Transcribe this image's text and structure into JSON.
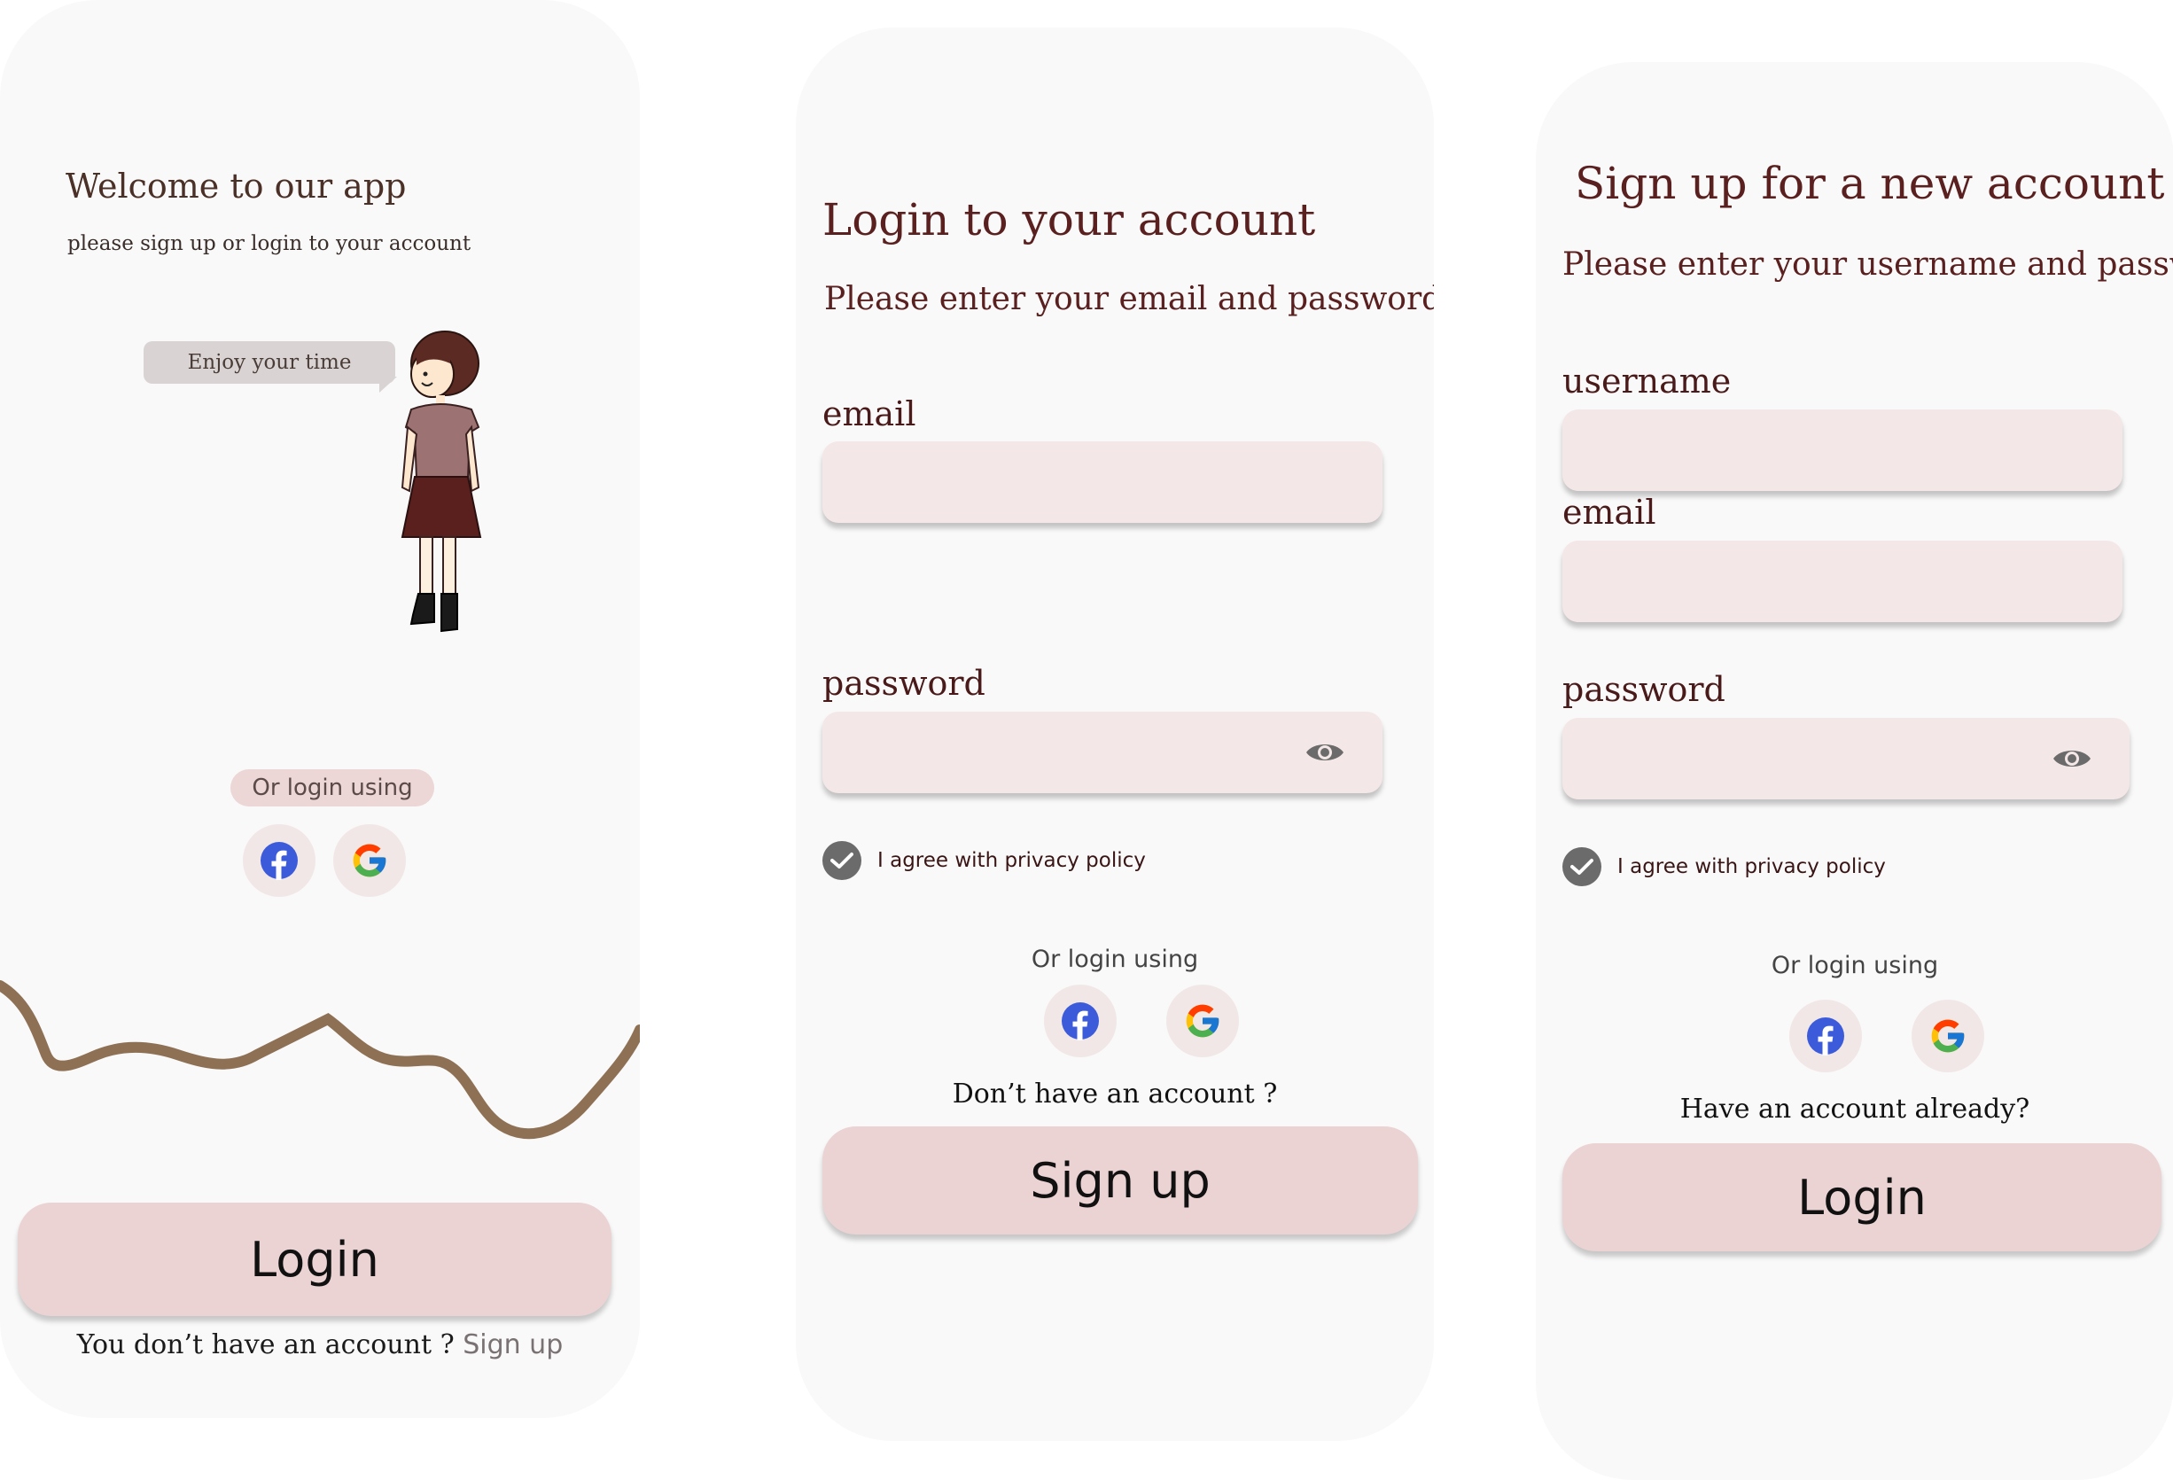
{
  "welcome": {
    "title": "Welcome to our app",
    "subtitle": "please sign up or login to your account",
    "bubble": "Enjoy your time",
    "or_login": "Or login using",
    "login_button": "Login",
    "no_account": "You don’t have an account ?",
    "signup_link": "Sign up"
  },
  "login": {
    "title": "Login to your account",
    "subtitle": "Please enter your email and password",
    "email_label": "email",
    "password_label": "password",
    "privacy": "I agree with privacy policy",
    "or_login": "Or login using",
    "question": "Don’t have an account ?",
    "signup_button": "Sign up"
  },
  "signup": {
    "title": "Sign up for a new account",
    "subtitle": "Please enter your username and password",
    "username_label": "username",
    "email_label": "email",
    "password_label": "password",
    "privacy": "I agree with privacy policy",
    "or_login": "Or login using",
    "question": "Have an account already?",
    "login_button": "Login"
  },
  "icons": {
    "facebook": "facebook-icon",
    "google": "google-icon",
    "eye": "eye-icon",
    "check": "check-icon"
  },
  "colors": {
    "card_bg": "#f9f9f9",
    "button_bg": "#ebd3d4",
    "field_bg": "#f4e7e7",
    "title_color": "#5a2020",
    "wave_color": "#8e7055",
    "facebook_blue": "#3b5bdb"
  }
}
